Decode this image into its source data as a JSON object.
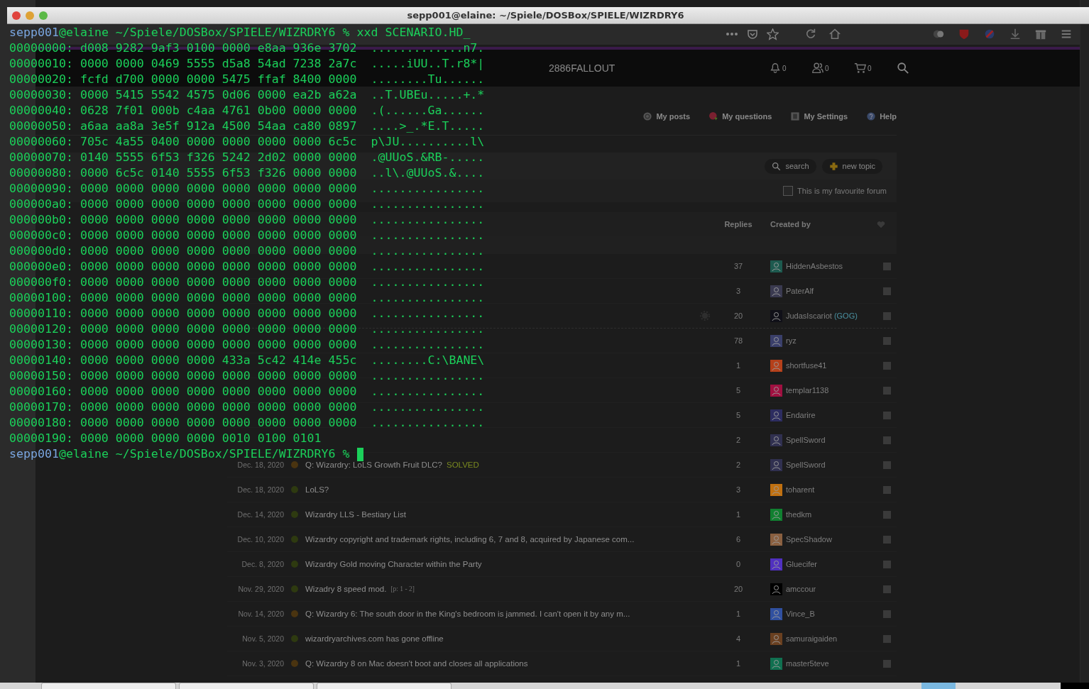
{
  "terminal": {
    "title": "sepp001@elaine: ~/Spiele/DOSBox/SPIELE/WIZRDRY6",
    "prompts": [
      {
        "user": "sepp001",
        "path": "@elaine ~/Spiele/DOSBox/SPIELE/WIZRDRY6 %",
        "command": "xxd SCENARIO.HD_"
      },
      {
        "user": "sepp001",
        "path": "@elaine ~/Spiele/DOSBox/SPIELE/WIZRDRY6 %"
      }
    ],
    "output": [
      "00000000: d008 9282 9af3 0100 0000 e8aa 936e 3702  .............n7.",
      "00000010: 0000 0000 0469 5555 d5a8 54ad 7238 2a7c  .....iUU..T.r8*|",
      "00000020: fcfd d700 0000 0000 5475 ffaf 8400 0000  ........Tu......",
      "00000030: 0000 5415 5542 4575 0d06 0000 ea2b a62a  ..T.UBEu.....+.*",
      "00000040: 0628 7f01 000b c4aa 4761 0b00 0000 0000  .(......Ga......",
      "00000050: a6aa aa8a 3e5f 912a 4500 54aa ca80 0897  ....>_.*E.T.....",
      "00000060: 705c 4a55 0400 0000 0000 0000 0000 6c5c  p\\JU..........l\\",
      "00000070: 0140 5555 6f53 f326 5242 2d02 0000 0000  .@UUoS.&RB-.....",
      "00000080: 0000 6c5c 0140 5555 6f53 f326 0000 0000  ..l\\.@UUoS.&....",
      "00000090: 0000 0000 0000 0000 0000 0000 0000 0000  ................",
      "000000a0: 0000 0000 0000 0000 0000 0000 0000 0000  ................",
      "000000b0: 0000 0000 0000 0000 0000 0000 0000 0000  ................",
      "000000c0: 0000 0000 0000 0000 0000 0000 0000 0000  ................",
      "000000d0: 0000 0000 0000 0000 0000 0000 0000 0000  ................",
      "000000e0: 0000 0000 0000 0000 0000 0000 0000 0000  ................",
      "000000f0: 0000 0000 0000 0000 0000 0000 0000 0000  ................",
      "00000100: 0000 0000 0000 0000 0000 0000 0000 0000  ................",
      "00000110: 0000 0000 0000 0000 0000 0000 0000 0000  ................",
      "00000120: 0000 0000 0000 0000 0000 0000 0000 0000  ................",
      "00000130: 0000 0000 0000 0000 0000 0000 0000 0000  ................",
      "00000140: 0000 0000 0000 0000 433a 5c42 414e 455c  ........C:\\BANE\\",
      "00000150: 0000 0000 0000 0000 0000 0000 0000 0000  ................",
      "00000160: 0000 0000 0000 0000 0000 0000 0000 0000  ................",
      "00000170: 0000 0000 0000 0000 0000 0000 0000 0000  ................",
      "00000180: 0000 0000 0000 0000 0000 0000 0000 0000  ................",
      "00000190: 0000 0000 0000 0000 0010 0100 0101"
    ]
  },
  "forum": {
    "nav": [
      {
        "label": "2886FALLOUT"
      }
    ],
    "counters": [
      {
        "kind": "bell",
        "count": "0"
      },
      {
        "kind": "friends",
        "count": "0"
      },
      {
        "kind": "cart",
        "count": "0"
      }
    ],
    "links": [
      {
        "kind": "posts",
        "label": "My posts"
      },
      {
        "kind": "questions",
        "label": "My questions"
      },
      {
        "kind": "settings",
        "label": "My Settings"
      },
      {
        "kind": "help",
        "label": "Help"
      }
    ],
    "actions": [
      {
        "kind": "search",
        "label": "search"
      },
      {
        "kind": "new",
        "label": "new topic"
      }
    ],
    "favourite": {
      "label": "This is my favourite forum",
      "checked": false
    },
    "columns": [
      "Replies",
      "Created by"
    ],
    "topics": [
      {
        "replies": "37",
        "creator": "HiddenAsbestos",
        "color": "#1d5a4f",
        "checked": false
      },
      {
        "replies": "3",
        "creator": "PaterAlf",
        "color": "#3a3a50",
        "checked": false
      },
      {
        "replies": "20",
        "creator": "JudasIscariot",
        "tag": "(GOG)",
        "color": "#101018",
        "sticky_end": true,
        "gear": true,
        "checked": false
      },
      {
        "replies": "78",
        "creator": "ryz",
        "color": "#3a3f6a",
        "checked": false
      },
      {
        "replies": "1",
        "creator": "shortfuse41",
        "color": "#b5401a",
        "checked": false
      },
      {
        "replies": "5",
        "creator": "templar1138",
        "color": "#a01040",
        "checked": false
      },
      {
        "replies": "5",
        "creator": "Endarire",
        "color": "#2c2c60",
        "checked": false
      },
      {
        "replies": "2",
        "creator": "SpellSword",
        "color": "#303050",
        "checked": false
      },
      {
        "date": "Dec. 18, 2020",
        "kind": "question",
        "title": "Q: Wizardry: LoLS Growth Fruit DLC?",
        "solved": "SOLVED",
        "replies": "2",
        "creator": "SpellSword",
        "color": "#303050",
        "checked": false
      },
      {
        "date": "Dec. 18, 2020",
        "kind": "discussion",
        "title": "LoLS?",
        "replies": "3",
        "creator": "toharent",
        "color": "#c07010",
        "checked": false
      },
      {
        "date": "Dec. 14, 2020",
        "kind": "discussion",
        "title": "Wizardry LLS - Bestiary List",
        "replies": "1",
        "creator": "thedkm",
        "color": "#108030",
        "checked": false
      },
      {
        "date": "Dec. 10, 2020",
        "kind": "discussion",
        "title": "Wizardry copyright and trademark rights, including 6, 7 and 8, acquired by Japanese com...",
        "replies": "6",
        "creator": "SpecShadow",
        "color": "#8a6040",
        "checked": false
      },
      {
        "date": "Dec. 8, 2020",
        "kind": "discussion",
        "title": "Wizardry Gold moving Character within the Party",
        "replies": "0",
        "creator": "Gluecifer",
        "color": "#5030c0",
        "checked": false
      },
      {
        "date": "Nov. 29, 2020",
        "kind": "discussion",
        "title": "Wizadry 8 speed mod.",
        "pages": "[p: 1 - 2]",
        "replies": "20",
        "creator": "amccour",
        "color": "#000000",
        "checked": false
      },
      {
        "date": "Nov. 14, 2020",
        "kind": "question",
        "title": "Q: Wizardry 6: The south door in the King's bedroom is jammed. I can't open it by any m...",
        "replies": "1",
        "creator": "Vince_B",
        "color": "#3050a0",
        "checked": false
      },
      {
        "date": "Nov. 5, 2020",
        "kind": "discussion",
        "title": "wizardryarchives.com has gone offline",
        "replies": "4",
        "creator": "samuraigaiden",
        "color": "#6a4020",
        "checked": false
      },
      {
        "date": "Nov. 3, 2020",
        "kind": "question",
        "title": "Q: Wizardry 8 on Mac doesn't boot and closes all applications",
        "replies": "1",
        "creator": "master5teve",
        "color": "#107050",
        "checked": false
      }
    ]
  }
}
